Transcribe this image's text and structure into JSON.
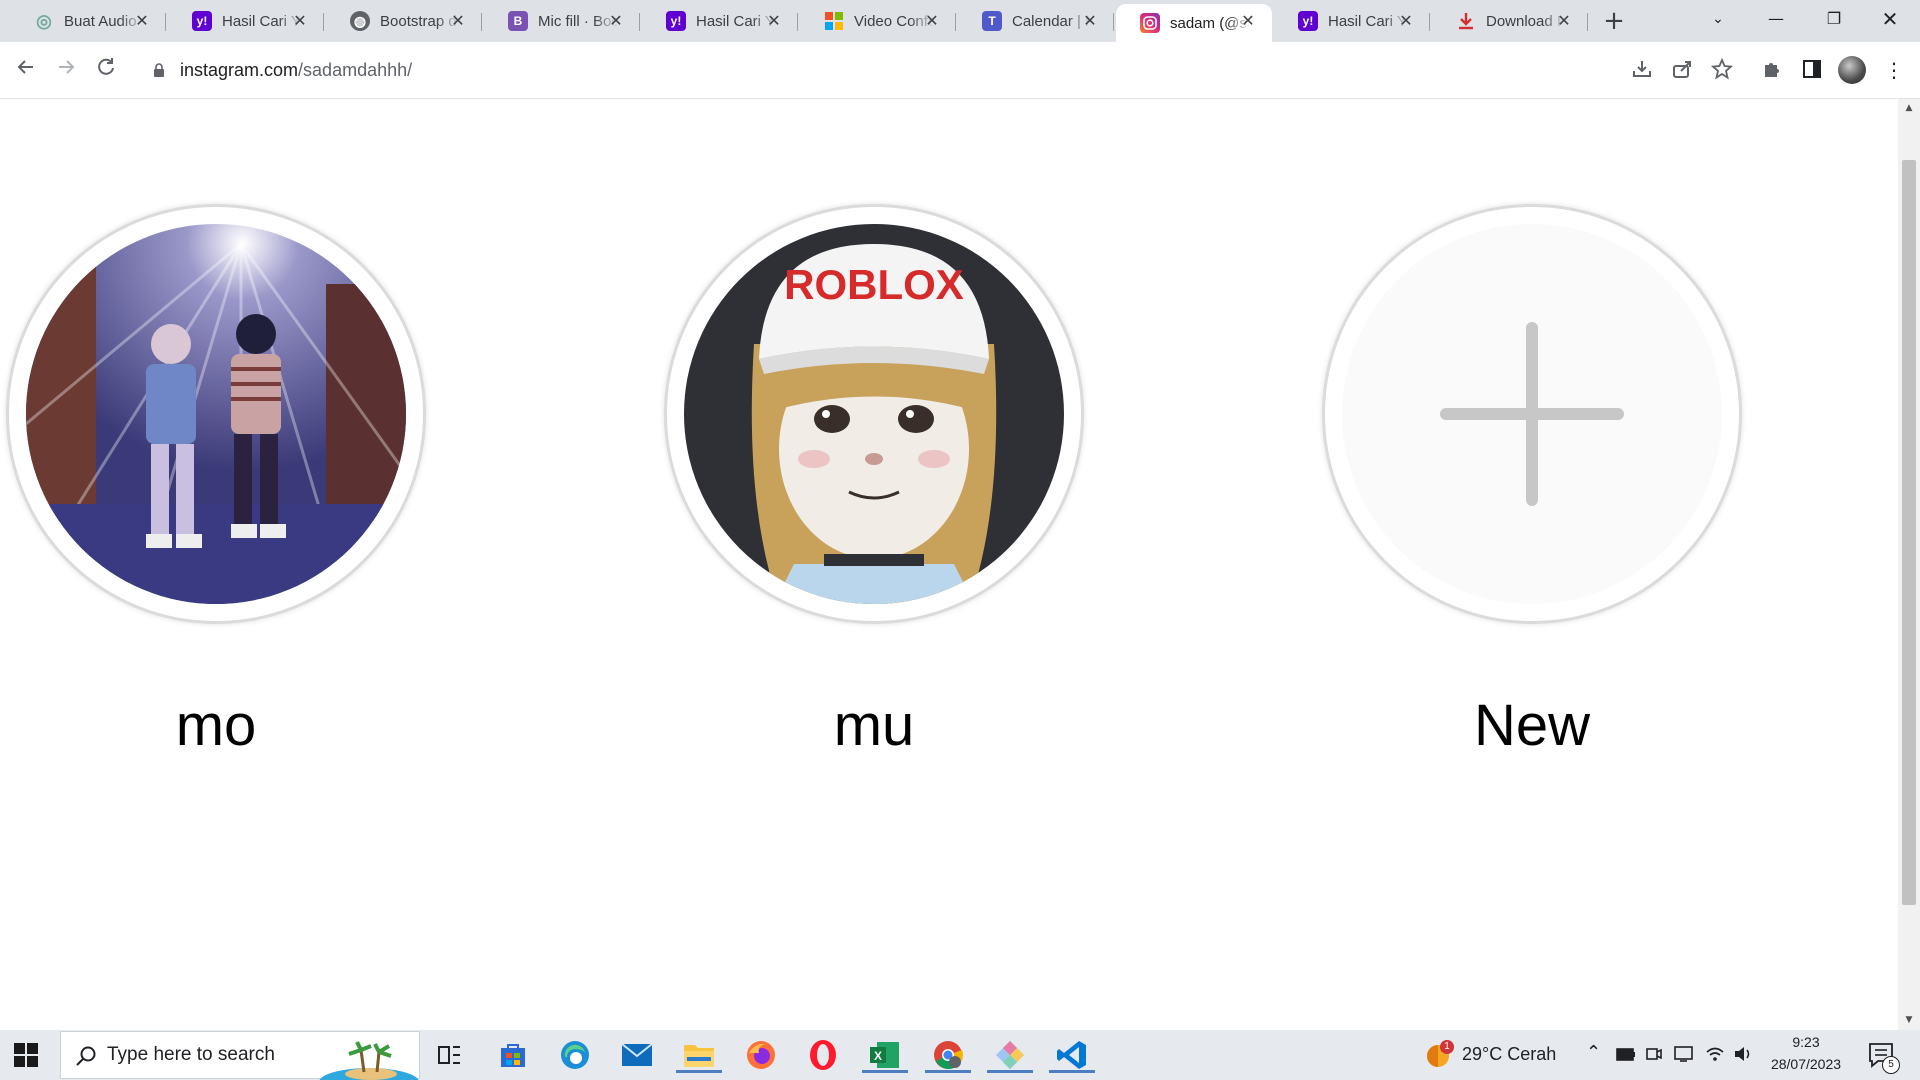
{
  "browser": {
    "tabs": [
      {
        "title": "Buat Audio",
        "icon": "chatgpt-icon",
        "color": "#74aa9c",
        "glyph": "◎"
      },
      {
        "title": "Hasil Cari Y",
        "icon": "yahoo-icon",
        "color": "#6001d2",
        "glyph": "y!"
      },
      {
        "title": "Bootstrap d",
        "icon": "globe-icon",
        "color": "#5f6368",
        "glyph": "◍"
      },
      {
        "title": "Mic fill · Boo",
        "icon": "bootstrap-icon",
        "color": "#7952b3",
        "glyph": "B"
      },
      {
        "title": "Hasil Cari Y",
        "icon": "yahoo-icon",
        "color": "#6001d2",
        "glyph": "y!"
      },
      {
        "title": "Video Confe",
        "icon": "microsoft-icon",
        "color": "#ffffff",
        "glyph": ""
      },
      {
        "title": "Calendar | M",
        "icon": "teams-icon",
        "color": "#5059c9",
        "glyph": "T"
      },
      {
        "title": "sadam (@sa",
        "icon": "instagram-icon",
        "color": "#e1306c",
        "glyph": "◉",
        "active": true
      },
      {
        "title": "Hasil Cari Y",
        "icon": "yahoo-icon",
        "color": "#6001d2",
        "glyph": "y!"
      },
      {
        "title": "Download I",
        "icon": "download-icon",
        "color": "#ffffff",
        "glyph": "⤓"
      }
    ],
    "url_host": "instagram.com",
    "url_path": "/sadamdahhh/"
  },
  "highlights": [
    {
      "label": "mo",
      "type": "image"
    },
    {
      "label": "mu",
      "type": "image"
    },
    {
      "label": "New",
      "type": "new"
    }
  ],
  "roblox_cap_text": "ROBLOX",
  "taskbar": {
    "search_placeholder": "Type here to search",
    "weather": "29°C  Cerah",
    "weather_badge": "1",
    "time": "9:23",
    "date": "28/07/2023",
    "notification_count": "5"
  }
}
